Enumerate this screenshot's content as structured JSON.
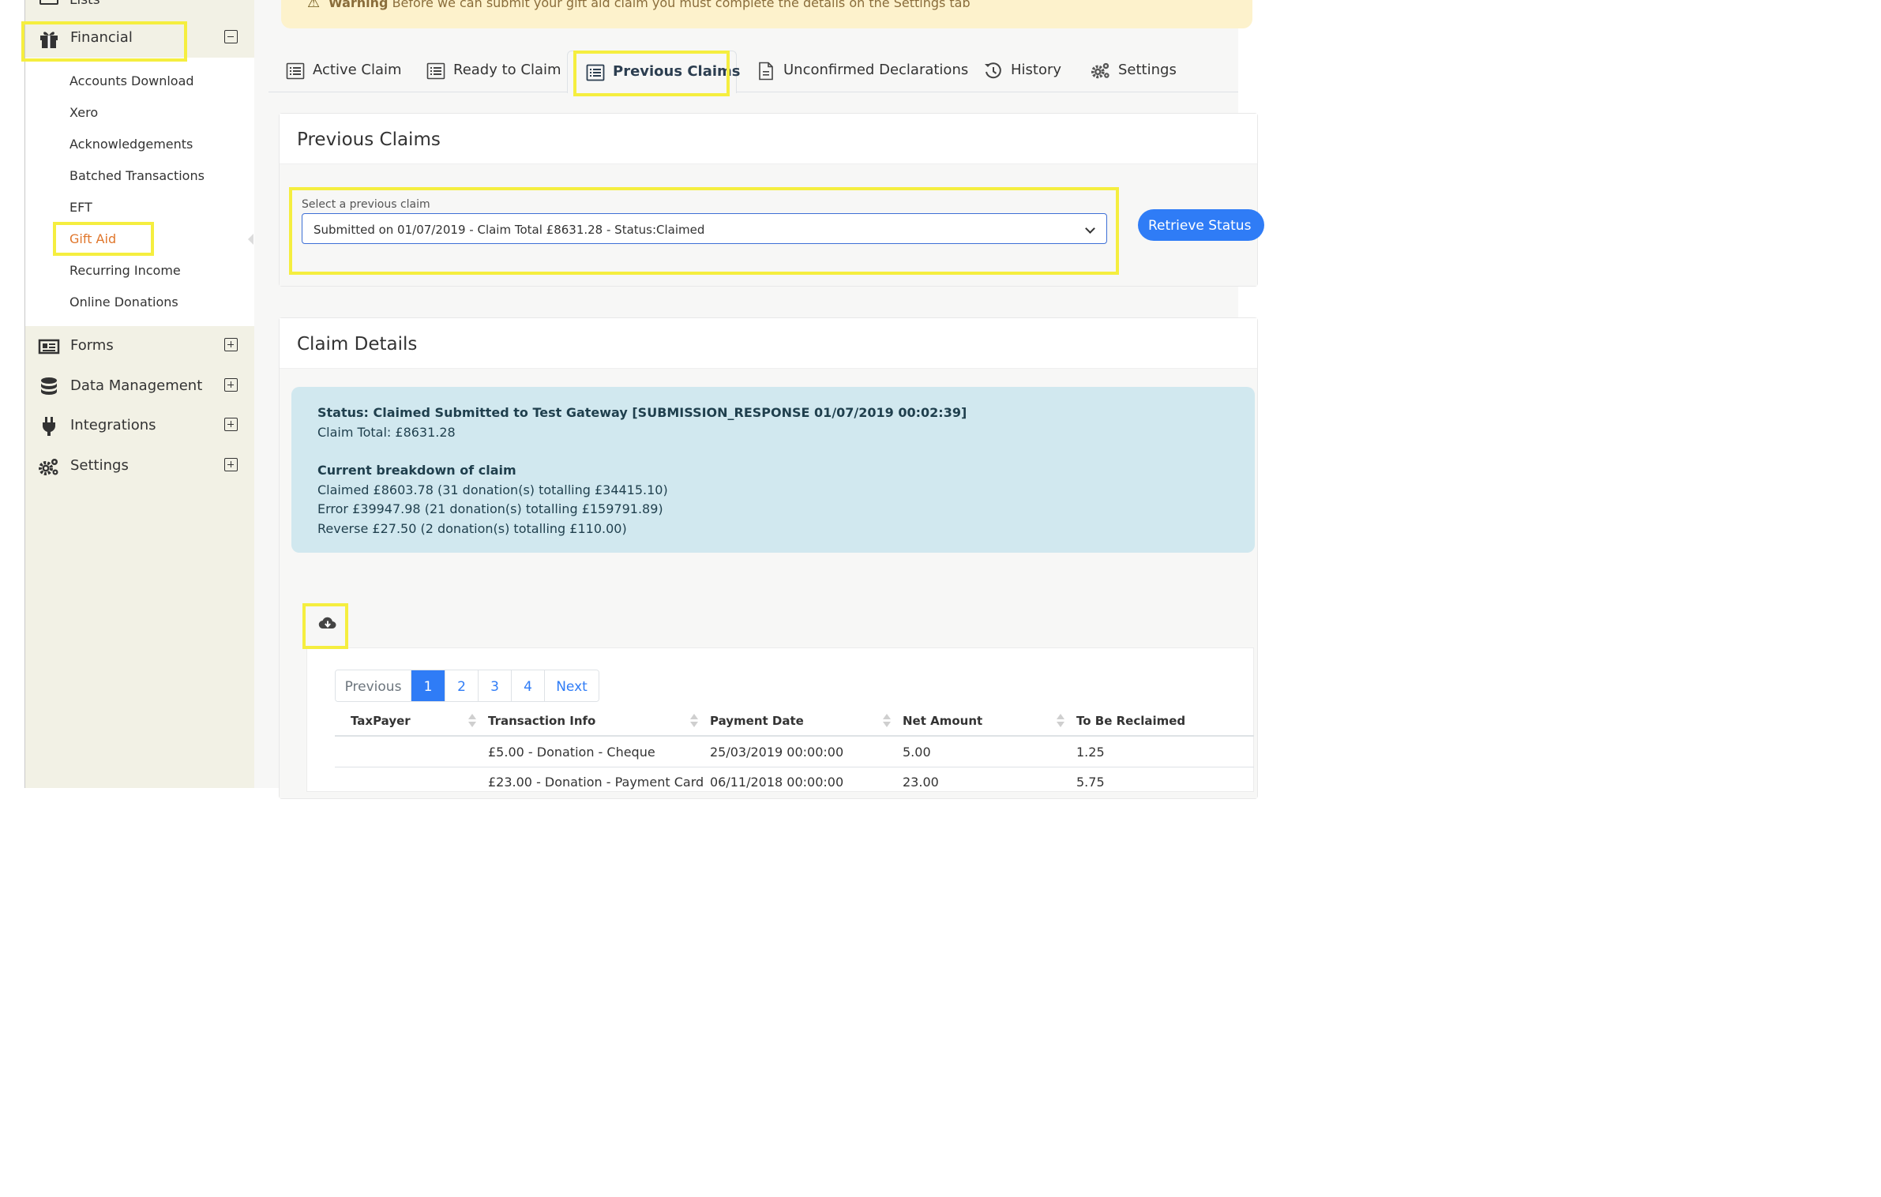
{
  "sidebar": {
    "lists_label": "Lists",
    "financial": {
      "label": "Financial",
      "items": [
        "Accounts Download",
        "Xero",
        "Acknowledgements",
        "Batched Transactions",
        "EFT",
        "Gift Aid",
        "Recurring Income",
        "Online Donations"
      ],
      "active_item": "Gift Aid"
    },
    "sections": [
      {
        "label": "Forms",
        "icon": "newspaper-icon"
      },
      {
        "label": "Data Management",
        "icon": "database-icon"
      },
      {
        "label": "Integrations",
        "icon": "plug-icon"
      },
      {
        "label": "Settings",
        "icon": "gears-icon"
      }
    ]
  },
  "warning": {
    "strong": "Warning",
    "text": "Before we can submit your gift aid claim you must complete the details on the Settings tab"
  },
  "tabs": [
    {
      "label": "Active Claim",
      "icon": "list-icon"
    },
    {
      "label": "Ready to Claim",
      "icon": "list-icon"
    },
    {
      "label": "Previous Claims",
      "icon": "list-icon",
      "active": true
    },
    {
      "label": "Unconfirmed Declarations",
      "icon": "document-icon"
    },
    {
      "label": "History",
      "icon": "history-icon"
    },
    {
      "label": "Settings",
      "icon": "gears-icon"
    }
  ],
  "previous_claims": {
    "title": "Previous Claims",
    "select_label": "Select a previous claim",
    "select_value": "Submitted on 01/07/2019 - Claim Total £8631.28 - Status:Claimed",
    "retrieve_button": "Retrieve Status"
  },
  "claim_details": {
    "title": "Claim Details",
    "status": "Status: Claimed Submitted to Test Gateway [SUBMISSION_RESPONSE 01/07/2019 00:02:39]",
    "claim_total": "Claim Total: £8631.28",
    "breakdown_title": "Current breakdown of claim",
    "breakdown": [
      "Claimed £8603.78 (31 donation(s) totalling £34415.10)",
      "Error £39947.98 (21 donation(s) totalling £159791.89)",
      "Reverse £27.50 (2 donation(s) totalling £110.00)"
    ]
  },
  "pagination": {
    "previous": "Previous",
    "pages": [
      "1",
      "2",
      "3",
      "4"
    ],
    "current": "1",
    "next": "Next"
  },
  "table": {
    "columns": [
      "TaxPayer",
      "Transaction Info",
      "Payment Date",
      "Net Amount",
      "To Be Reclaimed"
    ],
    "rows": [
      {
        "taxpayer": "",
        "info": "£5.00 - Donation - Cheque",
        "date": "25/03/2019 00:00:00",
        "net": "5.00",
        "reclaim": "1.25"
      },
      {
        "taxpayer": "",
        "info": "£23.00 - Donation - Payment Card",
        "date": "06/11/2018 00:00:00",
        "net": "23.00",
        "reclaim": "5.75"
      }
    ]
  },
  "colors": {
    "highlight": "#f5ee3f",
    "accent": "#2f7cf6",
    "active_nav": "#e0762b",
    "sidebar_bg": "#f2f1e5",
    "status_bg": "#d1e8ef"
  }
}
